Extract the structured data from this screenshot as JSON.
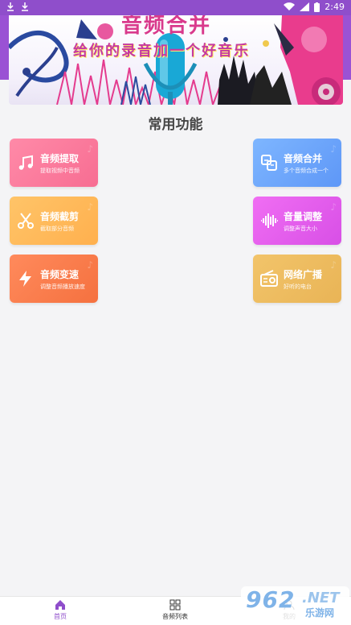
{
  "status_bar": {
    "time": "2:49"
  },
  "banner": {
    "title": "音频合并",
    "subtitle": "给你的录音加一个好音乐"
  },
  "section": {
    "title": "常用功能"
  },
  "cards": [
    {
      "title": "音频提取",
      "desc": "提取视频中音频"
    },
    {
      "title": "音频合并",
      "desc": "多个音频合成一个"
    },
    {
      "title": "音频截剪",
      "desc": "截取部分音频"
    },
    {
      "title": "音量调整",
      "desc": "调整声音大小"
    },
    {
      "title": "音频变速",
      "desc": "调整音频播放速度"
    },
    {
      "title": "网络广播",
      "desc": "好听的电台"
    }
  ],
  "colors": {
    "accent": "#8f4ecb",
    "pink": "#f76d92",
    "blue": "#5e97f7",
    "yellow": "#ffb04e",
    "magenta": "#d84fe6",
    "orange": "#f5713f",
    "gold": "#e9b456"
  },
  "nav": [
    {
      "label": "首页",
      "icon": "home-icon",
      "active": true
    },
    {
      "label": "音频列表",
      "icon": "grid-icon",
      "active": false
    },
    {
      "label": "我的",
      "icon": "user-icon",
      "active": false
    }
  ],
  "watermark": {
    "num": "962",
    "net": ".NET",
    "cn": "乐游网"
  }
}
